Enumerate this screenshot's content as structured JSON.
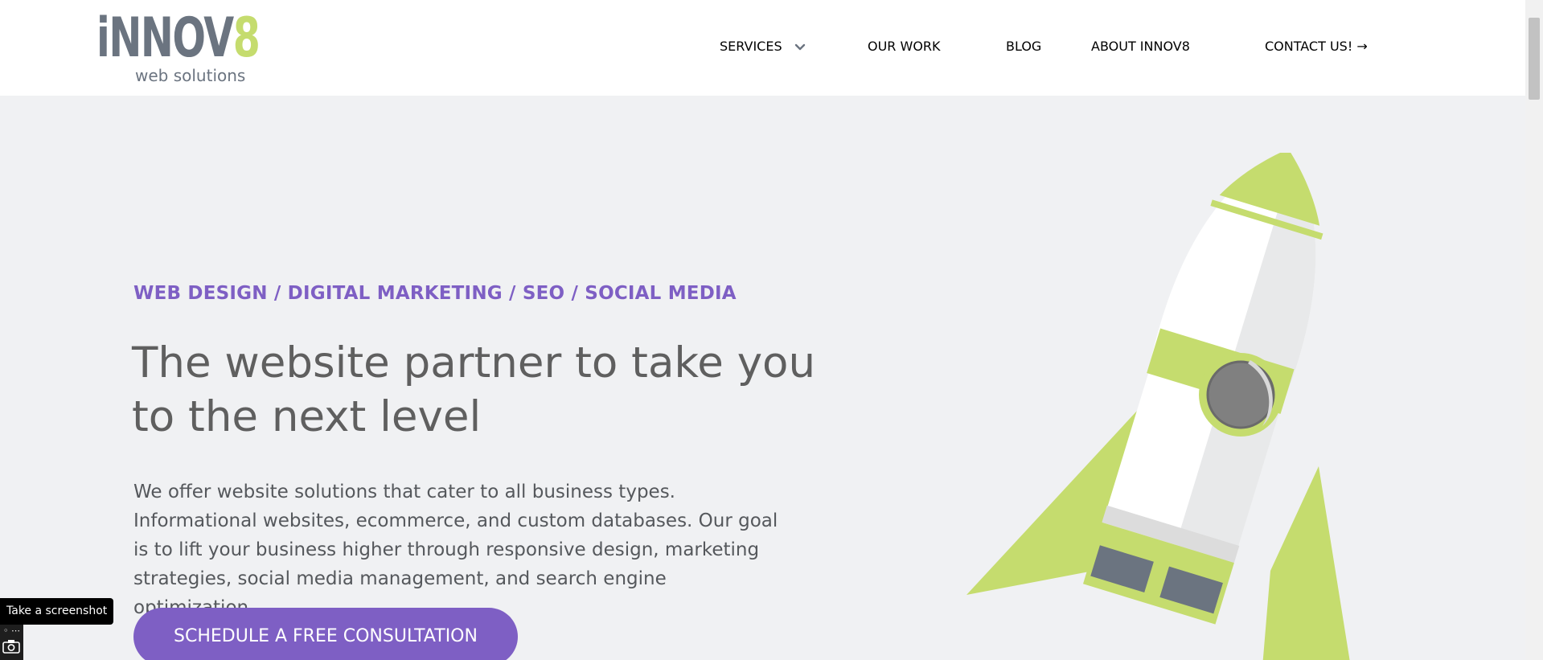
{
  "header": {
    "logo": {
      "text_main": "iNNOV",
      "text_eight": "8",
      "text_sub": "web solutions"
    },
    "nav": [
      {
        "label": "SERVICES",
        "has_dropdown": true
      },
      {
        "label": "OUR WORK"
      },
      {
        "label": "BLOG"
      },
      {
        "label": "ABOUT INNOV8"
      },
      {
        "label": "CONTACT US! →"
      }
    ]
  },
  "hero": {
    "tagline": "WEB DESIGN / DIGITAL MARKETING / SEO / SOCIAL MEDIA",
    "headline": "The website partner to take you to the next level",
    "body": "We offer website solutions that cater to all business types. Informational websites, ecommerce, and custom databases. Our goal is to lift your business higher through responsive design, marketing strategies, social media management, and search engine optimization.",
    "cta_label": "SCHEDULE A FREE CONSULTATION",
    "illustration": "rocket-illustration"
  },
  "screenshot_widget": {
    "tooltip": "Take a screenshot",
    "icon": "camera-icon"
  },
  "colors": {
    "accent_purple": "#7e5fc4",
    "accent_green": "#c5dc6e",
    "text_gray": "#6b7480",
    "background": "#f0f1f3"
  }
}
